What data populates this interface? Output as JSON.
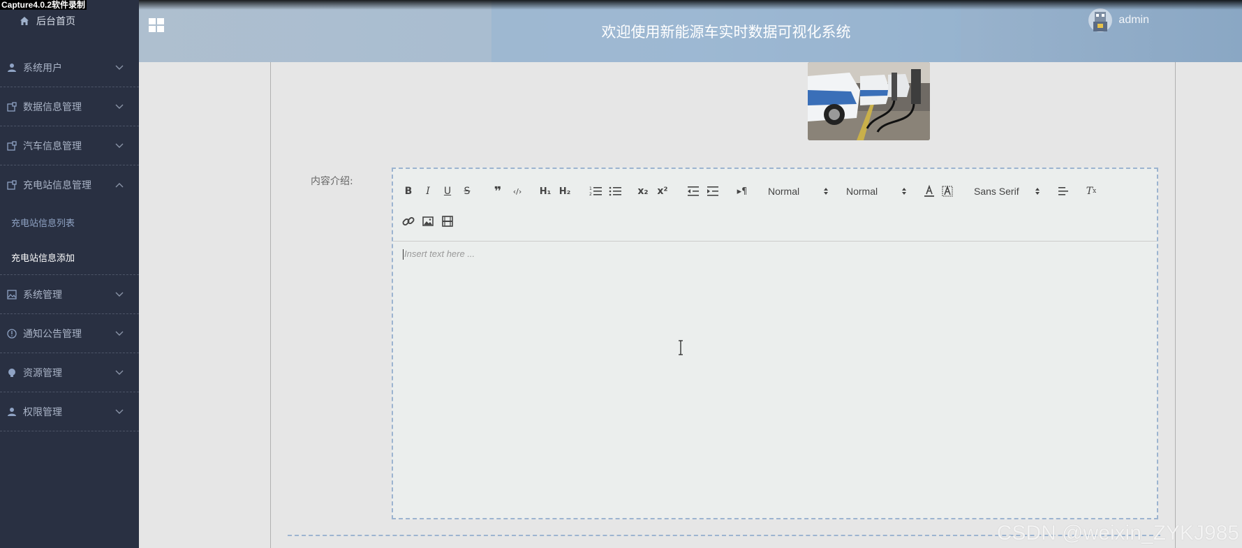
{
  "capture_label": "Capture4.0.2软件录制",
  "sidebar": {
    "home": "后台首页",
    "items": [
      {
        "label": "系统用户",
        "icon": "user-icon"
      },
      {
        "label": "数据信息管理",
        "icon": "doc-icon"
      },
      {
        "label": "汽车信息管理",
        "icon": "doc-icon"
      },
      {
        "label": "充电站信息管理",
        "icon": "doc-icon",
        "expanded": true,
        "children": [
          {
            "label": "充电站信息列表"
          },
          {
            "label": "充电站信息添加",
            "active": true
          }
        ]
      },
      {
        "label": "系统管理",
        "icon": "image-icon"
      },
      {
        "label": "通知公告管理",
        "icon": "info-icon"
      },
      {
        "label": "资源管理",
        "icon": "bulb-icon"
      },
      {
        "label": "权限管理",
        "icon": "user-icon"
      }
    ]
  },
  "header": {
    "title": "欢迎使用新能源车实时数据可视化系统",
    "username": "admin"
  },
  "form": {
    "content_label": "内容介绍:",
    "editor": {
      "placeholder": "Insert text here ...",
      "header_picker": "Normal",
      "size_picker": "Normal",
      "font_picker": "Sans Serif"
    }
  },
  "watermark": "CSDN @weixin_ZYKJ985",
  "colors": {
    "sidebar_bg": "#293042",
    "header_accent": "#a7bdd4",
    "editor_border": "#9cb4d0"
  }
}
